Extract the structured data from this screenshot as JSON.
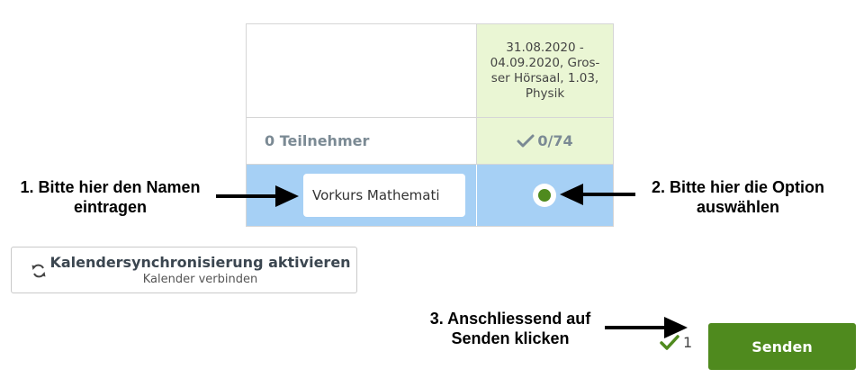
{
  "poll": {
    "option_header": "31.08.2020 - 04.09.2020, Gros- ser Hörsaal, 1.03, Physik",
    "participants_label": "0 Teilnehmer",
    "vote_count": "0/74",
    "name_input_value": "Vorkurs Mathemati",
    "option_selected": true
  },
  "annotations": {
    "step1": "1. Bitte hier den Namen eintragen",
    "step2": "2. Bitte hier die Option auswählen",
    "step3": "3. Anschliessend auf Senden klicken"
  },
  "calendar_sync": {
    "title": "Kalendersynchronisierung aktivieren",
    "subtitle": "Kalender verbinden",
    "icon": "sync-icon"
  },
  "footer": {
    "selected_count": "1",
    "send_label": "Senden"
  },
  "colors": {
    "accent_green": "#4f8a1e",
    "option_bg": "#eaf6d4",
    "row_highlight": "#a6d0f5",
    "muted_text": "#7b8a94"
  }
}
